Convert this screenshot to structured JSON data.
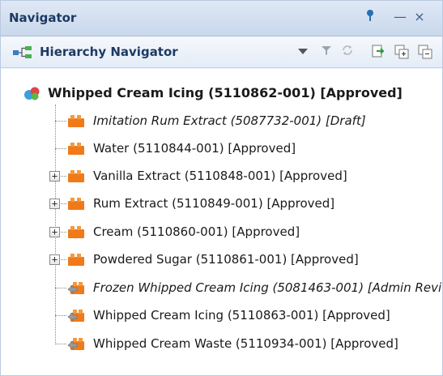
{
  "window": {
    "title": "Navigator",
    "controls": [
      "pin-icon",
      "minimize-icon",
      "close-icon"
    ]
  },
  "toolbar": {
    "label": "Hierarchy Navigator",
    "buttons": [
      "dropdown-arrow-icon",
      "filter-icon",
      "refresh-icon",
      "export-icon",
      "expand-all-icon",
      "collapse-all-icon"
    ]
  },
  "tree": {
    "root": {
      "label": "Whipped Cream Icing (5110862-001) [Approved]",
      "icon": "formula-icon"
    },
    "children": [
      {
        "label": "Imitation Rum Extract (5087732-001) [Draft]",
        "italic": true,
        "expandable": false,
        "icon": "ingredient-icon"
      },
      {
        "label": "Water (5110844-001) [Approved]",
        "italic": false,
        "expandable": false,
        "icon": "ingredient-icon"
      },
      {
        "label": "Vanilla Extract (5110848-001) [Approved]",
        "italic": false,
        "expandable": true,
        "icon": "ingredient-icon"
      },
      {
        "label": "Rum Extract (5110849-001) [Approved]",
        "italic": false,
        "expandable": true,
        "icon": "ingredient-icon"
      },
      {
        "label": "Cream (5110860-001) [Approved]",
        "italic": false,
        "expandable": true,
        "icon": "ingredient-icon"
      },
      {
        "label": "Powdered Sugar (5110861-001) [Approved]",
        "italic": false,
        "expandable": true,
        "icon": "ingredient-icon"
      },
      {
        "label": "Frozen Whipped Cream Icing (5081463-001) [Admin Revie",
        "italic": true,
        "expandable": false,
        "icon": "output-icon"
      },
      {
        "label": "Whipped Cream Icing (5110863-001) [Approved]",
        "italic": false,
        "expandable": false,
        "icon": "output-icon"
      },
      {
        "label": "Whipped Cream Waste (5110934-001) [Approved]",
        "italic": false,
        "expandable": false,
        "icon": "output-icon"
      }
    ]
  },
  "colors": {
    "title_text": "#1d3a63",
    "ingredient_orange": "#f07a1a",
    "panel_bg": "#eef3fa"
  }
}
